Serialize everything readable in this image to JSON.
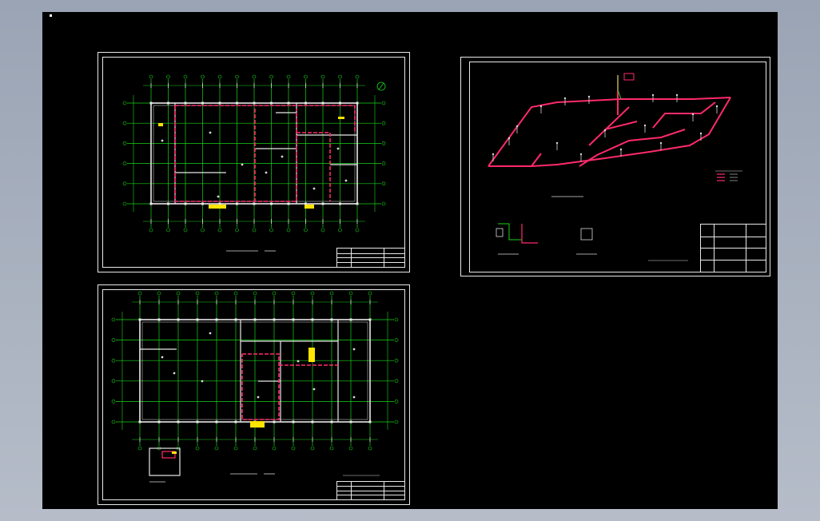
{
  "colors": {
    "canvas": "#000000",
    "frame": "#e8e8e8",
    "grid": "#19d419",
    "wall": "#e8e8e8",
    "pipe": "#ff2a6a",
    "highlight": "#ffe400",
    "text": "#d8d8d8"
  },
  "sheets": [
    {
      "name": "drawing-sheet-plan-1",
      "view": "floor-plan-drainage"
    },
    {
      "name": "drawing-sheet-isometric",
      "view": "pipe-system-isometric"
    },
    {
      "name": "drawing-sheet-plan-2",
      "view": "floor-plan-water-supply"
    }
  ],
  "icons": {
    "north_arrow": "north-arrow-icon",
    "cursor": "crosshair-cursor-icon"
  }
}
